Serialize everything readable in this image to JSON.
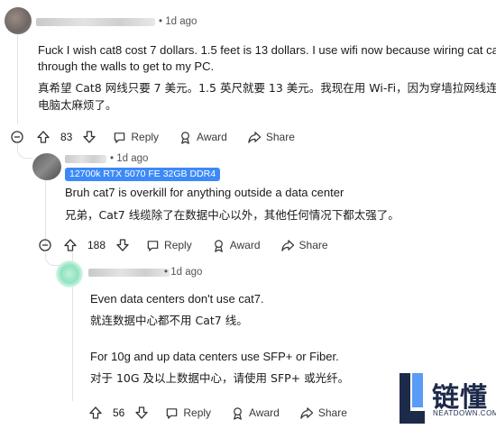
{
  "comment1": {
    "time": "1d ago",
    "text_en_line1": "Fuck I wish cat8 cost 7 dollars. 1.5 feet is 13 dollars. I use wifi now because wiring cat cable",
    "text_en_line2": "through the walls to get to my PC.",
    "text_zh_line1": "真希望 Cat8 网线只要 7 美元。1.5 英尺就要 13 美元。我现在用 Wi-Fi，因为穿墙拉网线连",
    "text_zh_line2": "电脑太麻烦了。",
    "votes": "83",
    "reply": "Reply",
    "award": "Award",
    "share": "Share"
  },
  "comment2": {
    "time": "1d ago",
    "flair": "12700k RTX 5070 FE 32GB DDR4",
    "text_en": "Bruh cat7 is overkill for anything outside a data center",
    "text_zh": "兄弟，Cat7 线缆除了在数据中心以外，其他任何情况下都太强了。",
    "votes": "188",
    "reply": "Reply",
    "award": "Award",
    "share": "Share"
  },
  "comment3": {
    "time": "1d ago",
    "text_en1": "Even data centers don't use cat7.",
    "text_zh1": "就连数据中心都不用 Cat7 线。",
    "text_en2": "For 10g and up data centers use SFP+ or Fiber.",
    "text_zh2": "对于 10G 及以上数据中心，请使用 SFP+ 或光纤。",
    "votes": "56",
    "reply": "Reply",
    "award": "Award",
    "share": "Share"
  },
  "watermark": {
    "title": "链懂",
    "sub": "NEATDOWN.COM"
  },
  "colors": {
    "flair_bg": "#3d8af7",
    "thread_line": "#dfe3e6",
    "text": "#1a1a1b"
  }
}
